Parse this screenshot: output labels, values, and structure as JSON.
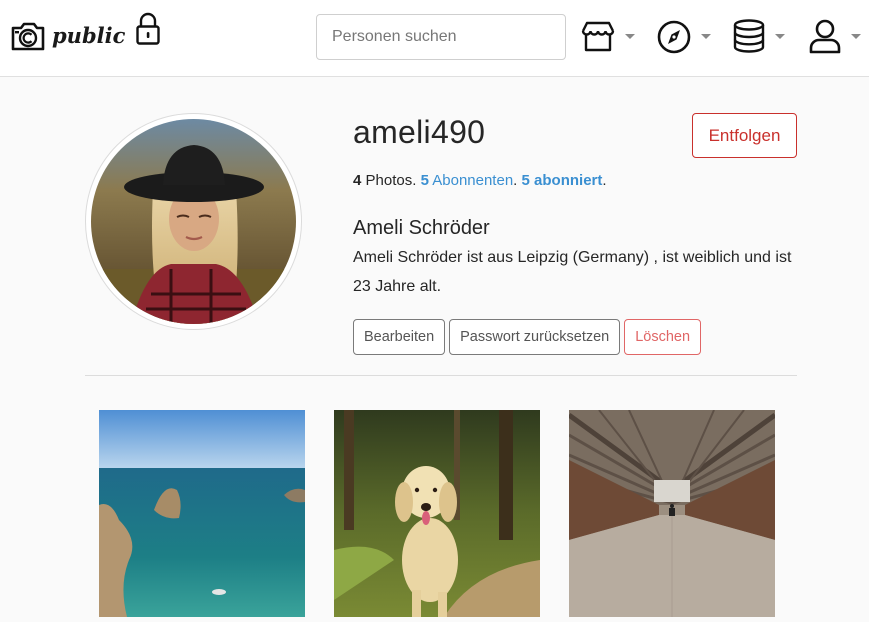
{
  "brand": {
    "name": "public"
  },
  "search": {
    "placeholder": "Personen suchen"
  },
  "nav": {
    "menus": [
      {
        "icon": "store-icon"
      },
      {
        "icon": "compass-icon"
      },
      {
        "icon": "database-icon"
      },
      {
        "icon": "user-icon"
      }
    ]
  },
  "profile": {
    "username": "ameli490",
    "unfollow_label": "Entfolgen",
    "photos_count": "4",
    "photos_label": "Photos.",
    "followers_count": "5",
    "followers_label": "Abonnenten",
    "following_count": "5",
    "following_label": "abonniert",
    "separator": ".",
    "full_name": "Ameli Schröder",
    "bio": "Ameli Schröder ist aus Leipzig (Germany) , ist weiblich und ist 23 Jahre alt."
  },
  "actions": {
    "edit": "Bearbeiten",
    "reset_password": "Passwort zurücksetzen",
    "delete": "Löschen"
  },
  "colors": {
    "link": "#3a8fd1",
    "danger": "#c9302c",
    "danger_light": "#e06666"
  }
}
